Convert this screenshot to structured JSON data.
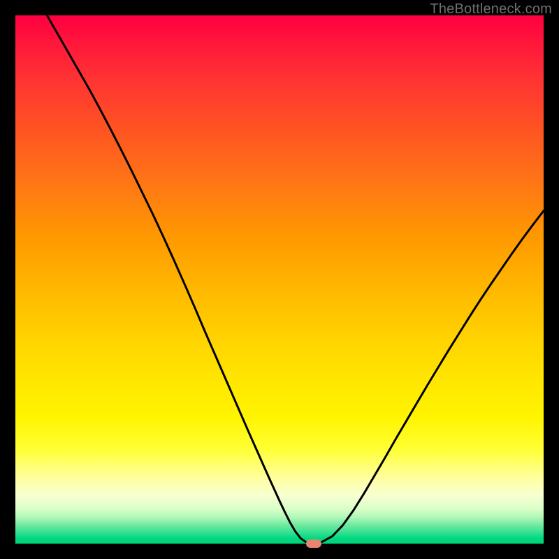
{
  "attribution": "TheBottleneck.com",
  "chart_data": {
    "type": "line",
    "title": "",
    "xlabel": "",
    "ylabel": "",
    "xlim": [
      0,
      100
    ],
    "ylim": [
      0,
      100
    ],
    "x": [
      6,
      8,
      10,
      12,
      14,
      16,
      18,
      20,
      22,
      24,
      26,
      28,
      30,
      32,
      34,
      36,
      38,
      40,
      42,
      44,
      46,
      48,
      50,
      51,
      52,
      53,
      54,
      55,
      56,
      57,
      58,
      60,
      62,
      64,
      66,
      68,
      70,
      72,
      74,
      76,
      78,
      80,
      82,
      84,
      86,
      88,
      90,
      92,
      94,
      96,
      98,
      100
    ],
    "values": [
      100,
      96.5,
      93,
      89.5,
      86,
      82.3,
      78.5,
      74.6,
      70.6,
      66.5,
      62.4,
      58.1,
      53.7,
      49.2,
      44.6,
      39.9,
      35.3,
      30.7,
      26.1,
      21.5,
      17.0,
      12.5,
      8.1,
      6.0,
      4.0,
      2.3,
      1.0,
      0.3,
      0.0,
      0.0,
      0.3,
      1.4,
      3.5,
      6.3,
      9.5,
      12.9,
      16.3,
      19.8,
      23.2,
      26.6,
      30.0,
      33.3,
      36.6,
      39.8,
      43.0,
      46.1,
      49.1,
      52.0,
      54.9,
      57.7,
      60.4,
      63.0
    ],
    "marker": {
      "x": 56.5,
      "y": 0
    },
    "gradient_stops": [
      {
        "pos": 0,
        "color": "#ff0040"
      },
      {
        "pos": 50,
        "color": "#ffcc00"
      },
      {
        "pos": 85,
        "color": "#ffff66"
      },
      {
        "pos": 100,
        "color": "#00d478"
      }
    ]
  }
}
